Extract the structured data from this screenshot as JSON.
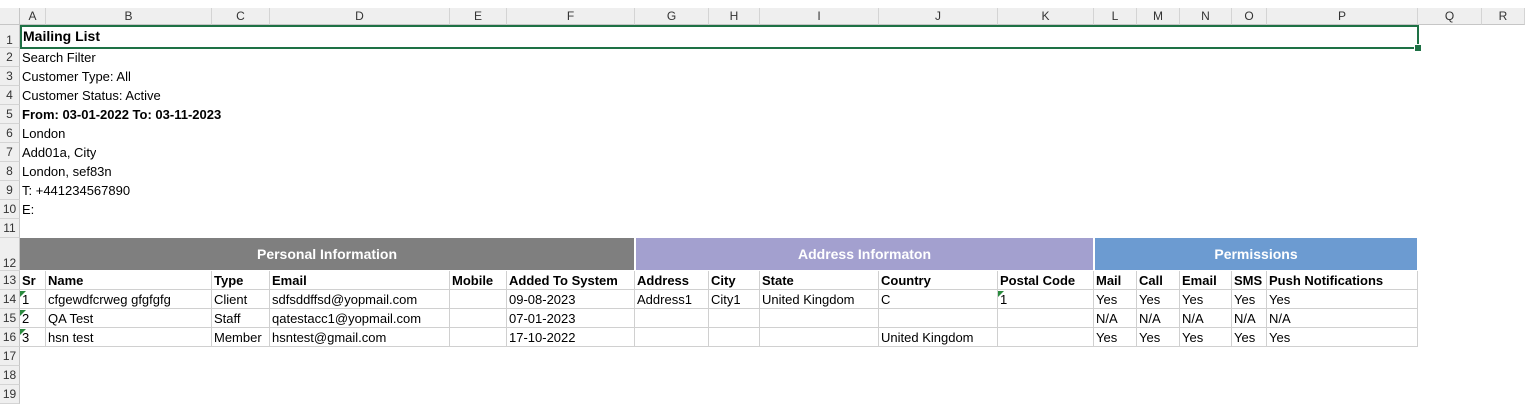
{
  "columns": [
    "A",
    "B",
    "C",
    "D",
    "E",
    "F",
    "G",
    "H",
    "I",
    "J",
    "K",
    "L",
    "M",
    "N",
    "O",
    "P",
    "Q",
    "R"
  ],
  "rows": [
    "1",
    "2",
    "3",
    "4",
    "5",
    "6",
    "7",
    "8",
    "9",
    "10",
    "11",
    "12",
    "13",
    "14",
    "15",
    "16",
    "17",
    "18",
    "19"
  ],
  "info": {
    "title": "Mailing List",
    "search_filter": "Search Filter",
    "customer_type": "Customer Type: All",
    "customer_status": "Customer Status: Active",
    "date_range": "From: 03-01-2022 To: 03-11-2023",
    "city": "London",
    "address_line": "Add01a, City",
    "address_line2": "London, sef83n",
    "phone": "T: +441234567890",
    "email": "E:"
  },
  "bands": {
    "personal": "Personal Information",
    "address": "Address Informaton",
    "permissions": "Permissions"
  },
  "colors": {
    "personal_band": "#7f7f7f",
    "address_band": "#a3a0cf",
    "permissions_band": "#6c9bd1",
    "selection": "#1e7145"
  },
  "table": {
    "headers": [
      "Sr",
      "Name",
      "Type",
      "Email",
      "Mobile",
      "Added To System",
      "Address",
      "City",
      "State",
      "Country",
      "Postal Code",
      "Mail",
      "Call",
      "Email",
      "SMS",
      "Push Notifications"
    ],
    "rows": [
      [
        "1",
        "cfgewdfcrweg gfgfgfg",
        "Client",
        "sdfsddffsd@yopmail.com",
        "",
        "09-08-2023",
        "Address1",
        "City1",
        "United Kingdom",
        "C",
        "1",
        "Yes",
        "Yes",
        "Yes",
        "Yes",
        "Yes"
      ],
      [
        "2",
        "QA Test",
        "Staff",
        "qatestacc1@yopmail.com",
        "",
        "07-01-2023",
        "",
        "",
        "",
        "",
        "",
        "N/A",
        "N/A",
        "N/A",
        "N/A",
        "N/A"
      ],
      [
        "3",
        "hsn test",
        "Member",
        "hsntest@gmail.com",
        "",
        "17-10-2022",
        "",
        "",
        "",
        "United Kingdom",
        "",
        "Yes",
        "Yes",
        "Yes",
        "Yes",
        "Yes"
      ]
    ]
  }
}
